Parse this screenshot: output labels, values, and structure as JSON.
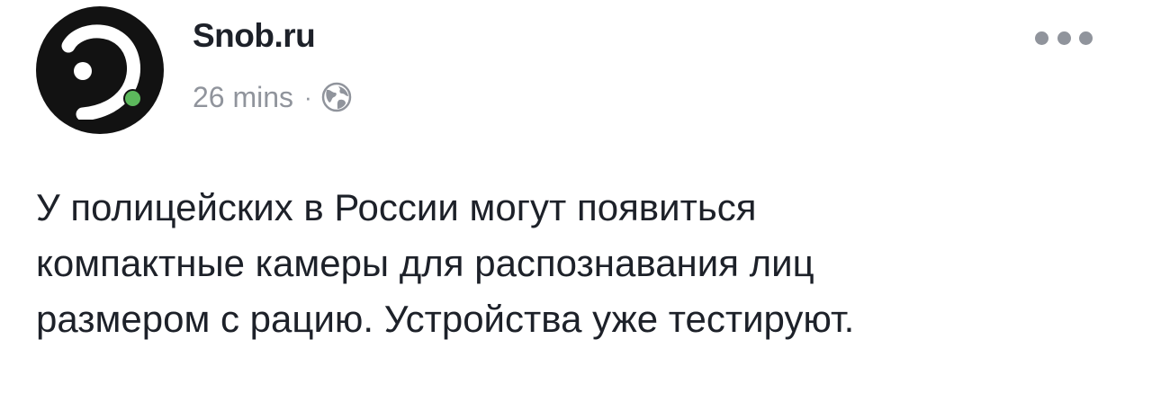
{
  "post": {
    "author": {
      "name": "Snob.ru",
      "avatar_icon": "snob-logo-icon",
      "status_color": "#5cb85c"
    },
    "timestamp": "26 mins",
    "separator": "·",
    "privacy_icon": "globe-icon",
    "more_icon": "more-options-icon",
    "text_lines": [
      "У полицейских в России могут появиться",
      "компактные камеры для распознавания лиц",
      "размером с рацию. Устройства уже тестируют."
    ]
  },
  "colors": {
    "text_primary": "#1d2129",
    "text_secondary": "#90949c",
    "avatar_bg": "#121212"
  }
}
